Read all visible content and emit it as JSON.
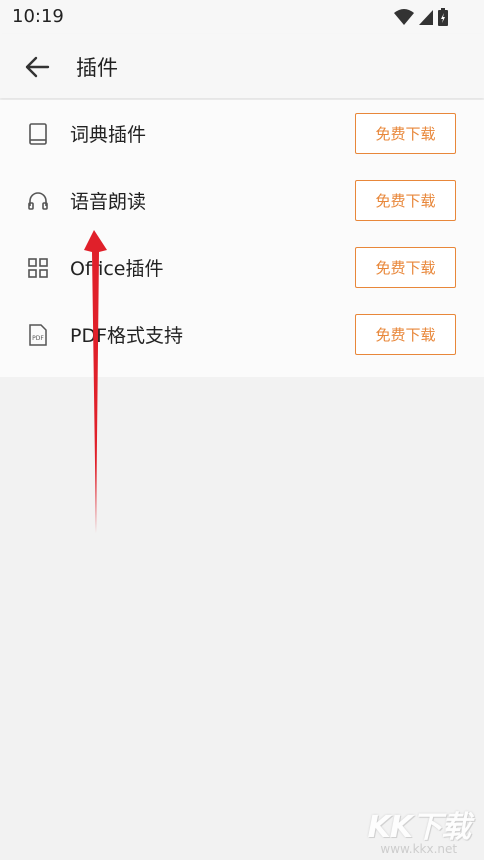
{
  "status_bar": {
    "time": "10:19",
    "icons": [
      "wifi-icon",
      "signal-icon",
      "battery-icon"
    ]
  },
  "app_bar": {
    "back_icon": "arrow-left-icon",
    "title": "插件"
  },
  "plugins": [
    {
      "icon": "book-icon",
      "label": "词典插件",
      "button": "免费下载"
    },
    {
      "icon": "headphones-icon",
      "label": "语音朗读",
      "button": "免费下载"
    },
    {
      "icon": "office-grid-icon",
      "label": "Office插件",
      "button": "免费下载"
    },
    {
      "icon": "pdf-file-icon",
      "label": "PDF格式支持",
      "button": "免费下载"
    }
  ],
  "colors": {
    "accent": "#e8873a",
    "annotation_arrow": "#e0202a",
    "background": "#f2f2f2"
  },
  "watermark": {
    "logo": "KK下载",
    "url": "www.kkx.net"
  }
}
